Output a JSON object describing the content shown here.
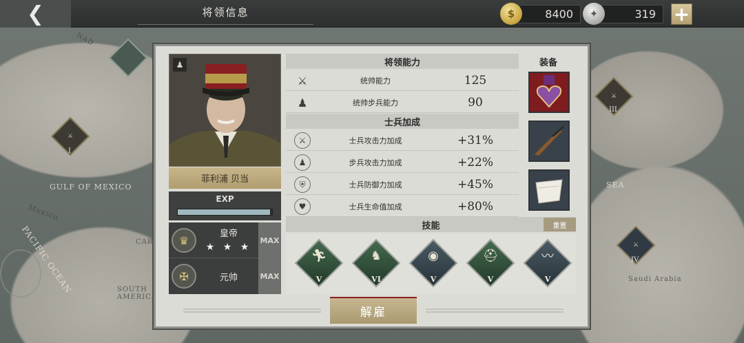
{
  "topbar": {
    "back_icon": "chevron-left-icon",
    "title": "将领信息",
    "gold": "8400",
    "silver": "319",
    "plus": "+"
  },
  "map": {
    "labels": [
      "GULF OF MEXICO",
      "Mexico",
      "PACIFIC OCEAN",
      "SOUTH AMERICA",
      "Saudi Arabia",
      "SEA",
      "CARI",
      "NAD"
    ],
    "badges": [
      "I",
      "III",
      "IV"
    ]
  },
  "general": {
    "name": "菲利浦 贝当",
    "exp_label": "EXP",
    "exp_progress": 0.98,
    "rank1_title": "皇帝",
    "rank1_stars": "★ ★ ★",
    "rank1_max": "MAX",
    "rank2_title": "元帅",
    "rank2_max": "MAX"
  },
  "abilities": {
    "header": "将领能力",
    "rows": [
      {
        "icon": "crossed-swords-icon",
        "name": "统帅能力",
        "value": "125"
      },
      {
        "icon": "infantry-icon",
        "name": "统帅步兵能力",
        "value": "90"
      }
    ]
  },
  "bonus": {
    "header": "士兵加成",
    "rows": [
      {
        "icon": "sword-attack-icon",
        "name": "士兵攻击力加成",
        "value": "+31%"
      },
      {
        "icon": "soldier-attack-icon",
        "name": "步兵攻击力加成",
        "value": "+22%"
      },
      {
        "icon": "shield-icon",
        "name": "士兵防御力加成",
        "value": "+45%"
      },
      {
        "icon": "heart-icon",
        "name": "士兵生命值加成",
        "value": "+80%"
      }
    ]
  },
  "equipment": {
    "header": "装备",
    "slots": [
      "purple-heart-medal-icon",
      "rifle-icon",
      "cloth-item-icon"
    ]
  },
  "skills": {
    "header": "技能",
    "reset": "重置",
    "items": [
      {
        "icon": "running-soldier-icon",
        "level": "V",
        "color": "green"
      },
      {
        "icon": "laurel-soldier-icon",
        "level": "VI",
        "color": "green"
      },
      {
        "icon": "eye-icon",
        "level": "V",
        "color": "slate"
      },
      {
        "icon": "helmet-wrench-icon",
        "level": "V",
        "color": "green"
      },
      {
        "icon": "barbed-wire-icon",
        "level": "V",
        "color": "slate"
      }
    ]
  },
  "actions": {
    "dismiss": "解雇"
  }
}
